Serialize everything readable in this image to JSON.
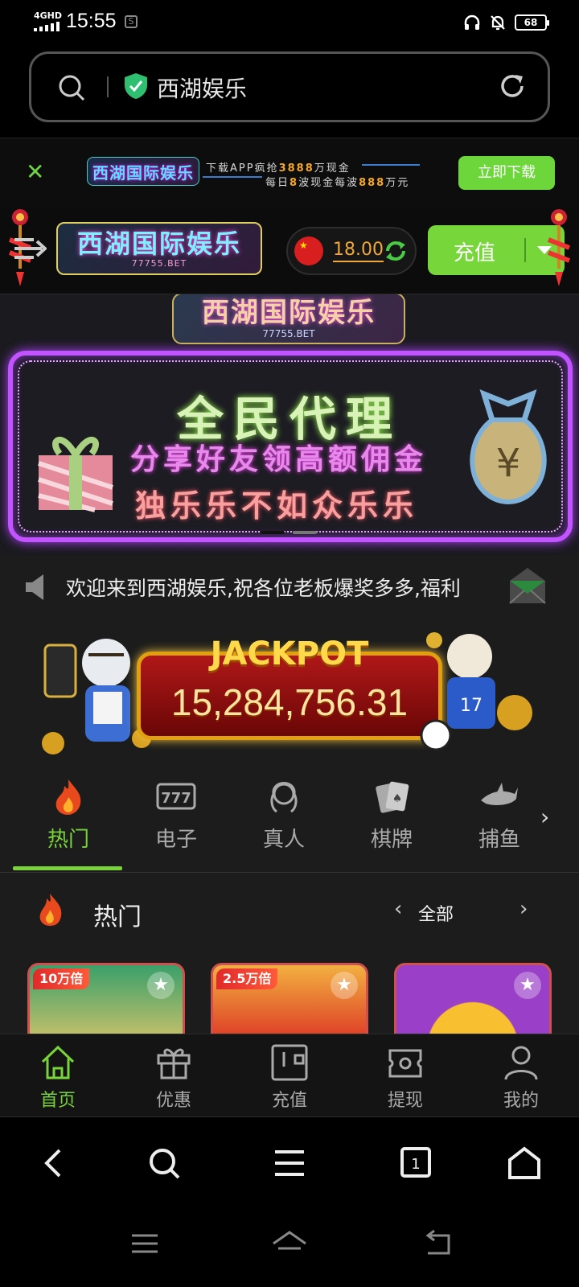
{
  "status_bar": {
    "network": "4GHD",
    "time": "15:55",
    "battery": "68",
    "icons": [
      "headphones-icon",
      "mute-icon",
      "battery-icon"
    ]
  },
  "browser": {
    "url_text": "西湖娱乐",
    "icons": [
      "search-icon",
      "verified-shield-icon",
      "reload-icon"
    ]
  },
  "download_banner": {
    "logo_text": "西湖国际娱乐",
    "line1_pre": "下载APP疯抢",
    "line1_num": "3888",
    "line1_post": "万现金",
    "line2_pre": "每日",
    "line2_num": "8",
    "line2_mid": "波现金每波",
    "line2_num2": "888",
    "line2_post": "万元",
    "button": "立即下载"
  },
  "header": {
    "logo_main": "西湖国际娱乐",
    "logo_sub": "77755.BET",
    "balance": "18.00",
    "recharge": "充值"
  },
  "promo": {
    "logo_main": "西湖国际娱乐",
    "logo_sub": "77755.BET",
    "title": "全民代理",
    "line2": "分享好友领高额佣金",
    "line3": "独乐乐不如众乐乐",
    "bag_symbol": "¥"
  },
  "marquee": {
    "text": "欢迎来到西湖娱乐,祝各位老板爆奖多多,福利"
  },
  "jackpot": {
    "title": "JACKPOT",
    "value": "15,284,756.31"
  },
  "categories": [
    {
      "label": "热门",
      "icon": "fire-icon",
      "active": true
    },
    {
      "label": "电子",
      "icon": "slot-777-icon",
      "active": false
    },
    {
      "label": "真人",
      "icon": "live-dealer-icon",
      "active": false
    },
    {
      "label": "棋牌",
      "icon": "cards-icon",
      "active": false
    },
    {
      "label": "捕鱼",
      "icon": "shark-icon",
      "active": false
    }
  ],
  "hot": {
    "title": "热门",
    "filter": "全部",
    "cards": [
      {
        "tag": "10万倍"
      },
      {
        "tag": "2.5万倍"
      },
      {
        "tag": ""
      }
    ]
  },
  "tabbar": [
    {
      "label": "首页",
      "icon": "home-icon",
      "active": true
    },
    {
      "label": "优惠",
      "icon": "gift-icon",
      "active": false
    },
    {
      "label": "充值",
      "icon": "wallet-icon",
      "active": false
    },
    {
      "label": "提现",
      "icon": "withdraw-icon",
      "active": false
    },
    {
      "label": "我的",
      "icon": "user-icon",
      "active": false
    }
  ],
  "browser_nav": {
    "tab_count": "1"
  },
  "colors": {
    "accent": "#78d43a",
    "balance": "#f0a838"
  }
}
